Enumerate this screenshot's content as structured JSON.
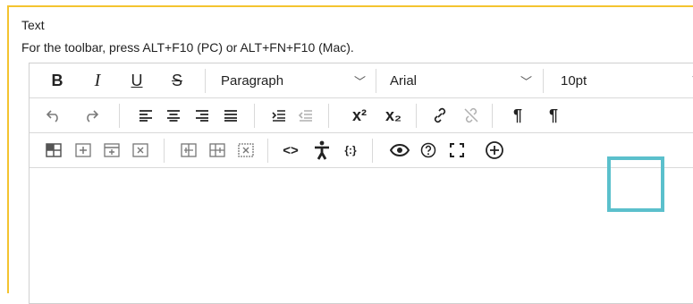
{
  "field": {
    "label": "Text",
    "hint": "For the toolbar, press ALT+F10 (PC) or ALT+FN+F10 (Mac)."
  },
  "toolbar": {
    "bold": "B",
    "italic": "I",
    "underline": "U",
    "strike": "S",
    "block_format": "Paragraph",
    "font_family": "Arial",
    "font_size": "10pt",
    "superscript": "x²",
    "subscript": "x₂",
    "code": "<>",
    "ltr": "¶",
    "rtl": "¶"
  },
  "colors": {
    "frame_border": "#f4c430",
    "highlight": "#5bc0cc"
  },
  "icons": [
    "undo-icon",
    "redo-icon",
    "align-left-icon",
    "align-center-icon",
    "align-right-icon",
    "justify-icon",
    "indent-icon",
    "outdent-icon",
    "link-icon",
    "unlink-icon",
    "table-icon",
    "preview-icon",
    "help-icon",
    "fullscreen-icon",
    "add-icon",
    "accessibility-icon",
    "equation-icon"
  ]
}
